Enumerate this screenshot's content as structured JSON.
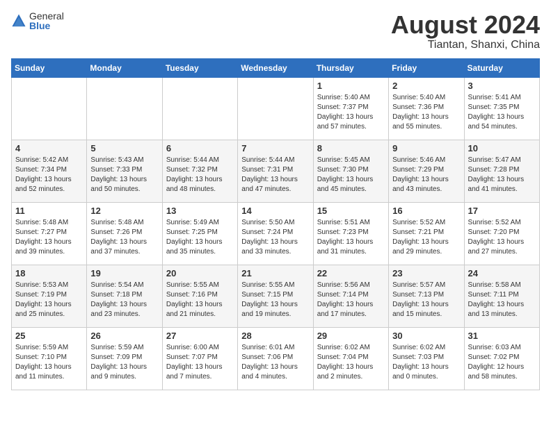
{
  "header": {
    "logo_general": "General",
    "logo_blue": "Blue",
    "title": "August 2024",
    "subtitle": "Tiantan, Shanxi, China"
  },
  "weekdays": [
    "Sunday",
    "Monday",
    "Tuesday",
    "Wednesday",
    "Thursday",
    "Friday",
    "Saturday"
  ],
  "weeks": [
    [
      {
        "day": "",
        "info": ""
      },
      {
        "day": "",
        "info": ""
      },
      {
        "day": "",
        "info": ""
      },
      {
        "day": "",
        "info": ""
      },
      {
        "day": "1",
        "info": "Sunrise: 5:40 AM\nSunset: 7:37 PM\nDaylight: 13 hours and 57 minutes."
      },
      {
        "day": "2",
        "info": "Sunrise: 5:40 AM\nSunset: 7:36 PM\nDaylight: 13 hours and 55 minutes."
      },
      {
        "day": "3",
        "info": "Sunrise: 5:41 AM\nSunset: 7:35 PM\nDaylight: 13 hours and 54 minutes."
      }
    ],
    [
      {
        "day": "4",
        "info": "Sunrise: 5:42 AM\nSunset: 7:34 PM\nDaylight: 13 hours and 52 minutes."
      },
      {
        "day": "5",
        "info": "Sunrise: 5:43 AM\nSunset: 7:33 PM\nDaylight: 13 hours and 50 minutes."
      },
      {
        "day": "6",
        "info": "Sunrise: 5:44 AM\nSunset: 7:32 PM\nDaylight: 13 hours and 48 minutes."
      },
      {
        "day": "7",
        "info": "Sunrise: 5:44 AM\nSunset: 7:31 PM\nDaylight: 13 hours and 47 minutes."
      },
      {
        "day": "8",
        "info": "Sunrise: 5:45 AM\nSunset: 7:30 PM\nDaylight: 13 hours and 45 minutes."
      },
      {
        "day": "9",
        "info": "Sunrise: 5:46 AM\nSunset: 7:29 PM\nDaylight: 13 hours and 43 minutes."
      },
      {
        "day": "10",
        "info": "Sunrise: 5:47 AM\nSunset: 7:28 PM\nDaylight: 13 hours and 41 minutes."
      }
    ],
    [
      {
        "day": "11",
        "info": "Sunrise: 5:48 AM\nSunset: 7:27 PM\nDaylight: 13 hours and 39 minutes."
      },
      {
        "day": "12",
        "info": "Sunrise: 5:48 AM\nSunset: 7:26 PM\nDaylight: 13 hours and 37 minutes."
      },
      {
        "day": "13",
        "info": "Sunrise: 5:49 AM\nSunset: 7:25 PM\nDaylight: 13 hours and 35 minutes."
      },
      {
        "day": "14",
        "info": "Sunrise: 5:50 AM\nSunset: 7:24 PM\nDaylight: 13 hours and 33 minutes."
      },
      {
        "day": "15",
        "info": "Sunrise: 5:51 AM\nSunset: 7:23 PM\nDaylight: 13 hours and 31 minutes."
      },
      {
        "day": "16",
        "info": "Sunrise: 5:52 AM\nSunset: 7:21 PM\nDaylight: 13 hours and 29 minutes."
      },
      {
        "day": "17",
        "info": "Sunrise: 5:52 AM\nSunset: 7:20 PM\nDaylight: 13 hours and 27 minutes."
      }
    ],
    [
      {
        "day": "18",
        "info": "Sunrise: 5:53 AM\nSunset: 7:19 PM\nDaylight: 13 hours and 25 minutes."
      },
      {
        "day": "19",
        "info": "Sunrise: 5:54 AM\nSunset: 7:18 PM\nDaylight: 13 hours and 23 minutes."
      },
      {
        "day": "20",
        "info": "Sunrise: 5:55 AM\nSunset: 7:16 PM\nDaylight: 13 hours and 21 minutes."
      },
      {
        "day": "21",
        "info": "Sunrise: 5:55 AM\nSunset: 7:15 PM\nDaylight: 13 hours and 19 minutes."
      },
      {
        "day": "22",
        "info": "Sunrise: 5:56 AM\nSunset: 7:14 PM\nDaylight: 13 hours and 17 minutes."
      },
      {
        "day": "23",
        "info": "Sunrise: 5:57 AM\nSunset: 7:13 PM\nDaylight: 13 hours and 15 minutes."
      },
      {
        "day": "24",
        "info": "Sunrise: 5:58 AM\nSunset: 7:11 PM\nDaylight: 13 hours and 13 minutes."
      }
    ],
    [
      {
        "day": "25",
        "info": "Sunrise: 5:59 AM\nSunset: 7:10 PM\nDaylight: 13 hours and 11 minutes."
      },
      {
        "day": "26",
        "info": "Sunrise: 5:59 AM\nSunset: 7:09 PM\nDaylight: 13 hours and 9 minutes."
      },
      {
        "day": "27",
        "info": "Sunrise: 6:00 AM\nSunset: 7:07 PM\nDaylight: 13 hours and 7 minutes."
      },
      {
        "day": "28",
        "info": "Sunrise: 6:01 AM\nSunset: 7:06 PM\nDaylight: 13 hours and 4 minutes."
      },
      {
        "day": "29",
        "info": "Sunrise: 6:02 AM\nSunset: 7:04 PM\nDaylight: 13 hours and 2 minutes."
      },
      {
        "day": "30",
        "info": "Sunrise: 6:02 AM\nSunset: 7:03 PM\nDaylight: 13 hours and 0 minutes."
      },
      {
        "day": "31",
        "info": "Sunrise: 6:03 AM\nSunset: 7:02 PM\nDaylight: 12 hours and 58 minutes."
      }
    ]
  ]
}
